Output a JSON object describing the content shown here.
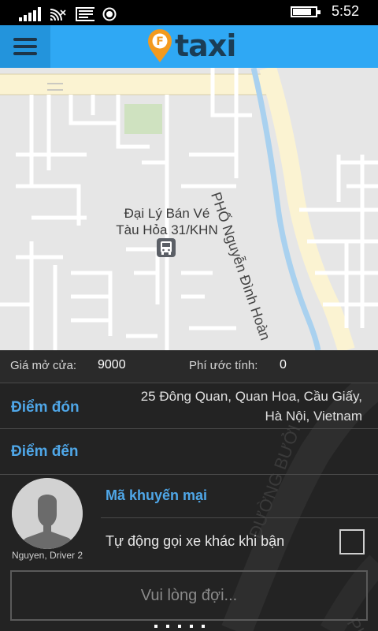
{
  "status_bar": {
    "time": "5:52",
    "icons": [
      "signal-icon",
      "wifi-icon",
      "message-icon",
      "location-icon",
      "battery-icon"
    ],
    "battery_level": 0.78
  },
  "header": {
    "menu_icon": "hamburger-menu-icon",
    "logo_letter": "F",
    "logo_text": "taxi",
    "colors": {
      "bar": "#2fa8f4",
      "menu_bg": "#2394dc",
      "pin": "#f39a1e",
      "logo_text": "#1b3d55"
    }
  },
  "map": {
    "poi_label_line1": "Đại Lý Bán Vé",
    "poi_label_line2": "Tàu Hỏa 31/KHN",
    "poi_icon": "bus-station-icon",
    "street_label": "PHỐ Nguyễn Đình Hoàn"
  },
  "fare": {
    "open_label": "Giá mở cửa:",
    "open_value": "9000",
    "estimate_label": "Phí ước tính:",
    "estimate_value": "0"
  },
  "pickup": {
    "label": "Điểm đón",
    "address_line1": "25 Đông Quan, Quan Hoa, Cầu Giấy,",
    "address_line2": "Hà Nội, Vietnam"
  },
  "destination": {
    "label": "Điểm đến"
  },
  "driver": {
    "name": "Nguyen, Driver 2",
    "avatar_icon": "avatar-placeholder-icon"
  },
  "promo": {
    "label": "Mã khuyến mại"
  },
  "auto_call": {
    "label": "Tự động gọi xe khác khi bận",
    "checked": false
  },
  "wait_button": {
    "label": "Vui lòng đợi..."
  },
  "background_map_labels": [
    "ĐƯỜNG BƯỞI",
    "PHỐ"
  ],
  "colors": {
    "accent_blue": "#4fa7e8",
    "panel_bg": "#232323"
  }
}
